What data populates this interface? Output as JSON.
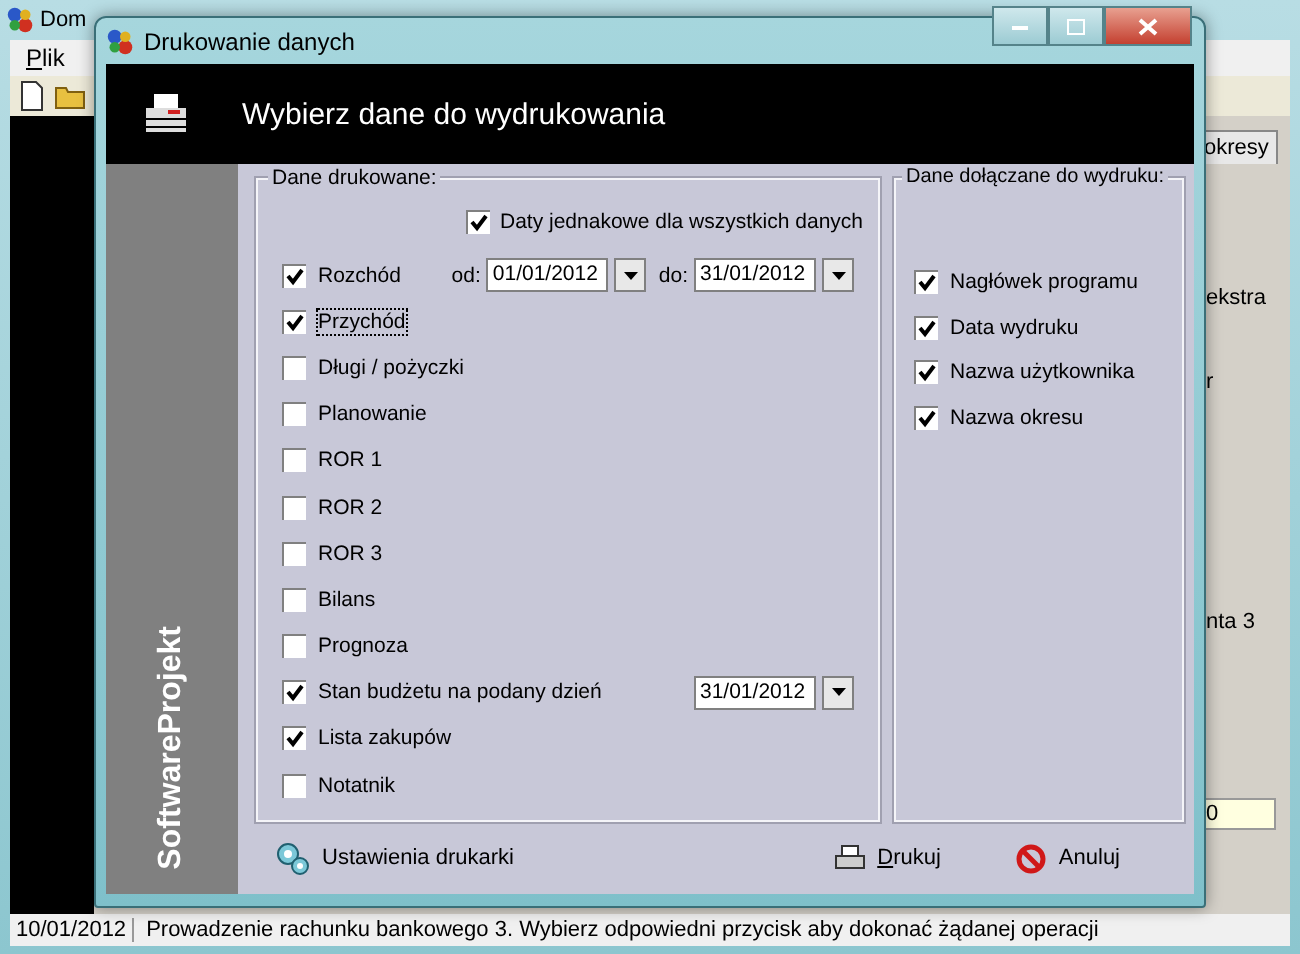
{
  "background_window": {
    "title": "Dom",
    "menu": [
      {
        "label": "Plik",
        "mnemonic": true
      }
    ],
    "tab": "okresy",
    "texts": [
      "ekstra",
      "r",
      "nta 3"
    ],
    "field_value": "0",
    "status_bar": [
      "10/01/2012",
      "Prowadzenie rachunku bankowego 3. Wybierz odpowiedni przycisk aby dokonać żądanej operacji"
    ]
  },
  "dialog": {
    "title": "Drukowanie danych",
    "header": "Wybierz dane do wydrukowania",
    "brand": "SoftwareProjekt",
    "printed_group": {
      "legend": "Dane drukowane:",
      "same_dates": {
        "label": "Daty jednakowe dla wszystkich danych",
        "checked": true
      },
      "items": [
        {
          "label": "Rozchód",
          "checked": true,
          "dates": [
            {
              "label": "od:",
              "value": "01/01/2012"
            },
            {
              "label": "do:",
              "value": "31/01/2012"
            }
          ]
        },
        {
          "label": "Przychód",
          "checked": true,
          "focused": true
        },
        {
          "label": "Długi / pożyczki",
          "checked": false
        },
        {
          "label": "Planowanie",
          "checked": false
        },
        {
          "label": "ROR 1",
          "checked": false
        },
        {
          "label": "ROR 2",
          "checked": false
        },
        {
          "label": "ROR 3",
          "checked": false
        },
        {
          "label": "Bilans",
          "checked": false
        },
        {
          "label": "Prognoza",
          "checked": false
        },
        {
          "label": "Stan budżetu na podany dzień",
          "checked": true,
          "dates": [
            {
              "value": "31/01/2012"
            }
          ]
        },
        {
          "label": "Lista zakupów",
          "checked": true
        },
        {
          "label": "Notatnik",
          "checked": false
        }
      ]
    },
    "attached_group": {
      "legend": "Dane dołączane do wydruku:",
      "items": [
        {
          "label": "Nagłówek programu",
          "checked": true
        },
        {
          "label": "Data wydruku",
          "checked": true
        },
        {
          "label": "Nazwa użytkownika",
          "checked": true
        },
        {
          "label": "Nazwa okresu",
          "checked": true
        }
      ]
    },
    "buttons": [
      {
        "label": "Ustawienia drukarki",
        "kind": "settings",
        "mnemonic": false
      },
      {
        "label": "Drukuj",
        "kind": "print",
        "mnemonic": true
      },
      {
        "label": "Anuluj",
        "kind": "cancel",
        "mnemonic": false
      }
    ]
  }
}
